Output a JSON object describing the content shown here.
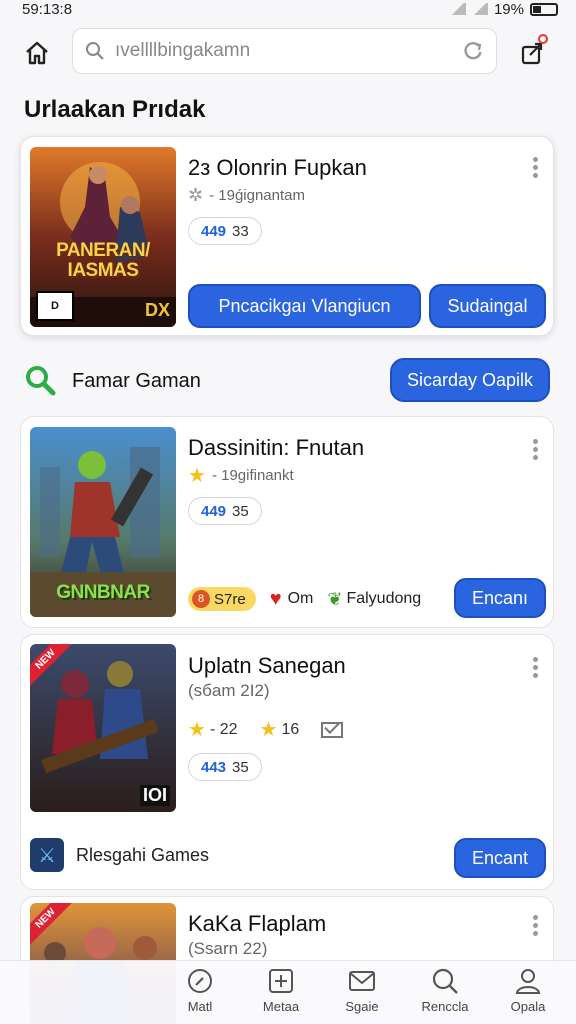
{
  "status": {
    "time": "59:13:8",
    "battery": "19%"
  },
  "search": {
    "text": "ıvellllbingakamn"
  },
  "section_title": "Urlaakan Prıdak",
  "featured": {
    "title": "2з Olonrin Fupkan",
    "subtitle": "- 19ǵignantam",
    "pill_num": "449",
    "pill_val": "33",
    "cover_title": "PANERAN/ IASMAS",
    "cover_rating": "D",
    "cover_corner": "DX",
    "btn_primary": "Pncacikgaı   Vlangiucn",
    "btn_secondary": "Sudaingal"
  },
  "find_row": {
    "label": "Famar Gaman",
    "button": "Sicarday Oapilk"
  },
  "game1": {
    "title": "Dassinitin: Fnutan",
    "subtitle": "- 19gifinankt",
    "pill_num": "449",
    "pill_val": "35",
    "cover_title": "GNNBNAR",
    "tag1": "S7re",
    "tag2": "Om",
    "tag3": "Falyudong",
    "button": "Encanı"
  },
  "game2": {
    "title": "Uplatn Sanegan",
    "subtitle": "(sбam 2I2)",
    "star1": "- 22",
    "star2": "16",
    "pill_num": "443",
    "pill_val": "35",
    "corner": "IOI",
    "ribbon": "NEW",
    "dev_label": "Rlesgahi Games",
    "button": "Encant"
  },
  "game3": {
    "title": "KaKa Flaplam",
    "subtitle": "(Ssarn 22)",
    "ribbon": "NEW"
  },
  "nav": [
    {
      "label": "Matl"
    },
    {
      "label": "Metaa"
    },
    {
      "label": "Sgaie"
    },
    {
      "label": "Renccla"
    },
    {
      "label": "Opala"
    }
  ],
  "colors": {
    "accent": "#2a64df",
    "green": "#2cae45",
    "yellow": "#f9d864"
  }
}
